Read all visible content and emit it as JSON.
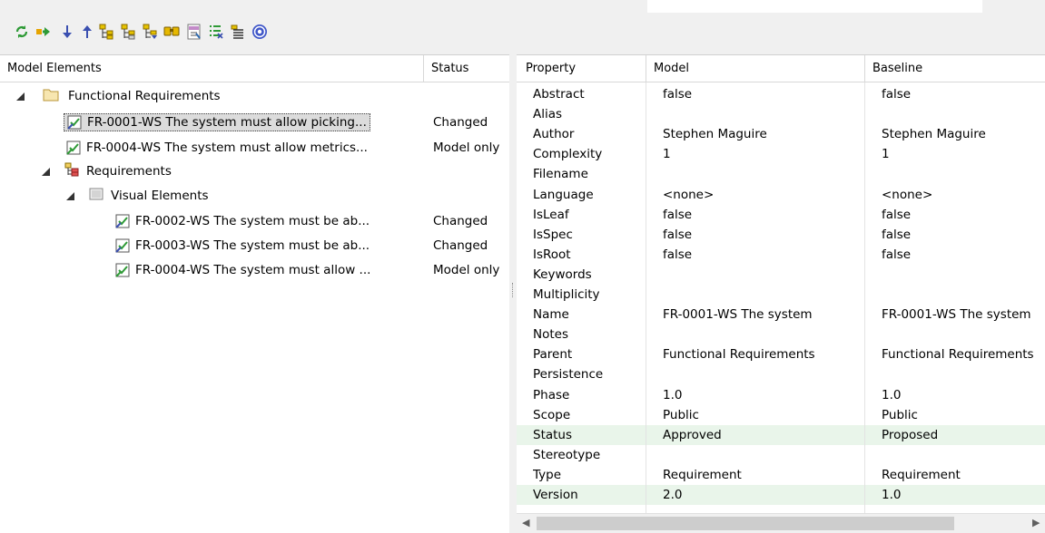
{
  "toolbar": {
    "buttons": [
      {
        "name": "refresh-icon"
      },
      {
        "name": "apply-changes-icon"
      },
      {
        "name": "next-difference-icon"
      },
      {
        "name": "previous-difference-icon"
      },
      {
        "name": "expand-changed-icon"
      },
      {
        "name": "collapse-icon"
      },
      {
        "name": "show-differences-icon"
      },
      {
        "name": "find-icon"
      },
      {
        "name": "xml-export-icon"
      },
      {
        "name": "filter-icon"
      },
      {
        "name": "options-icon"
      },
      {
        "name": "help-icon"
      }
    ]
  },
  "left_pane": {
    "headers": {
      "elements": "Model Elements",
      "status": "Status"
    },
    "tree": [
      {
        "label": "Functional Requirements",
        "status": "",
        "icon": "folder-icon"
      },
      {
        "label": "FR-0001-WS The system must allow picking...",
        "status": "Changed",
        "icon": "requirement-icon",
        "selected": true
      },
      {
        "label": "FR-0004-WS The system must allow metrics...",
        "status": "Model only",
        "icon": "requirement-icon"
      },
      {
        "label": "Requirements",
        "status": "",
        "icon": "package-icon"
      },
      {
        "label": "Visual Elements",
        "status": "",
        "icon": "diagram-icon"
      },
      {
        "label": "FR-0002-WS The system must be ab...",
        "status": "Changed",
        "icon": "requirement-icon"
      },
      {
        "label": "FR-0003-WS The system must be ab...",
        "status": "Changed",
        "icon": "requirement-icon"
      },
      {
        "label": "FR-0004-WS The system must allow ...",
        "status": "Model only",
        "icon": "requirement-icon"
      }
    ]
  },
  "right_pane": {
    "headers": {
      "property": "Property",
      "model": "Model",
      "baseline": "Baseline"
    },
    "rows": [
      {
        "property": "Abstract",
        "model": "false",
        "baseline": "false"
      },
      {
        "property": "Alias",
        "model": "",
        "baseline": ""
      },
      {
        "property": "Author",
        "model": "Stephen Maguire",
        "baseline": "Stephen Maguire"
      },
      {
        "property": "Complexity",
        "model": "1",
        "baseline": "1"
      },
      {
        "property": "Filename",
        "model": "",
        "baseline": ""
      },
      {
        "property": "Language",
        "model": "<none>",
        "baseline": "<none>"
      },
      {
        "property": "IsLeaf",
        "model": "false",
        "baseline": "false"
      },
      {
        "property": "IsSpec",
        "model": "false",
        "baseline": "false"
      },
      {
        "property": "IsRoot",
        "model": "false",
        "baseline": "false"
      },
      {
        "property": "Keywords",
        "model": "",
        "baseline": ""
      },
      {
        "property": "Multiplicity",
        "model": "",
        "baseline": ""
      },
      {
        "property": "Name",
        "model": "FR-0001-WS The system",
        "baseline": "FR-0001-WS The system"
      },
      {
        "property": "Notes",
        "model": "",
        "baseline": ""
      },
      {
        "property": "Parent",
        "model": "Functional Requirements",
        "baseline": "Functional Requirements"
      },
      {
        "property": "Persistence",
        "model": "",
        "baseline": ""
      },
      {
        "property": "Phase",
        "model": "1.0",
        "baseline": "1.0"
      },
      {
        "property": "Scope",
        "model": "Public",
        "baseline": "Public"
      },
      {
        "property": "Status",
        "model": "Approved",
        "baseline": "Proposed",
        "changed": true
      },
      {
        "property": "Stereotype",
        "model": "",
        "baseline": ""
      },
      {
        "property": "Type",
        "model": "Requirement",
        "baseline": "Requirement"
      },
      {
        "property": "Version",
        "model": "2.0",
        "baseline": "1.0",
        "changed": true
      }
    ]
  },
  "colors": {
    "changed_row": "#e9f5ea",
    "header_border": "#d8d8d8"
  }
}
